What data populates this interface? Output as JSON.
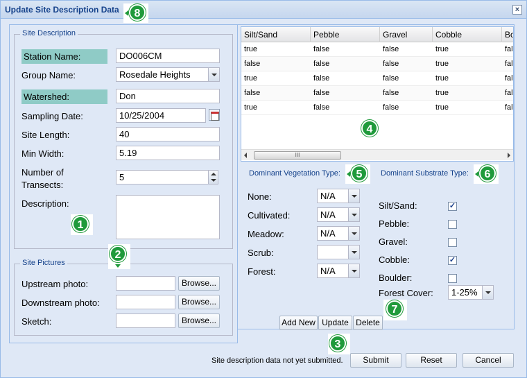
{
  "window": {
    "title": "Update Site Description Data",
    "close": "×"
  },
  "site_description": {
    "legend": "Site Description",
    "station_name": {
      "label": "Station Name:",
      "value": "DO006CM"
    },
    "group_name": {
      "label": "Group Name:",
      "value": "Rosedale Heights"
    },
    "watershed": {
      "label": "Watershed:",
      "value": "Don"
    },
    "sampling_date": {
      "label": "Sampling Date:",
      "value": "10/25/2004"
    },
    "site_length": {
      "label": "Site Length:",
      "value": "40"
    },
    "min_width": {
      "label": "Min Width:",
      "value": "5.19"
    },
    "transects": {
      "label_line1": "Number of",
      "label_line2": "Transects:",
      "value": "5"
    },
    "description": {
      "label": "Description:",
      "value": ""
    }
  },
  "site_pictures": {
    "legend": "Site Pictures",
    "rows": [
      {
        "label": "Upstream photo:",
        "button": "Browse..."
      },
      {
        "label": "Downstream photo:",
        "button": "Browse..."
      },
      {
        "label": "Sketch:",
        "button": "Browse..."
      }
    ]
  },
  "grid": {
    "columns": [
      "Silt/Sand",
      "Pebble",
      "Gravel",
      "Cobble",
      "Bo"
    ],
    "rows": [
      [
        "true",
        "false",
        "false",
        "true",
        "fal"
      ],
      [
        "false",
        "false",
        "false",
        "true",
        "fal"
      ],
      [
        "true",
        "false",
        "false",
        "true",
        "fal"
      ],
      [
        "false",
        "false",
        "false",
        "true",
        "fal"
      ],
      [
        "true",
        "false",
        "false",
        "true",
        "fal"
      ]
    ],
    "scroll_thumb": "III"
  },
  "vegetation": {
    "title": "Dominant Vegetation Type:",
    "items": [
      {
        "label": "None:",
        "value": "N/A"
      },
      {
        "label": "Cultivated:",
        "value": "N/A"
      },
      {
        "label": "Meadow:",
        "value": "N/A"
      },
      {
        "label": "Scrub:",
        "value": ""
      },
      {
        "label": "Forest:",
        "value": "N/A"
      }
    ]
  },
  "substrate": {
    "title": "Dominant Substrate Type:",
    "items": [
      {
        "label": "Silt/Sand:",
        "checked": true,
        "mark": "✓"
      },
      {
        "label": "Pebble:",
        "checked": false,
        "mark": ""
      },
      {
        "label": "Gravel:",
        "checked": false,
        "mark": ""
      },
      {
        "label": "Cobble:",
        "checked": true,
        "mark": "✓"
      },
      {
        "label": "Boulder:",
        "checked": false,
        "mark": ""
      }
    ],
    "forest_cover": {
      "label": "Forest Cover:",
      "value": "1-25%"
    }
  },
  "grid_buttons": {
    "add": "Add New",
    "update": "Update",
    "delete": "Delete"
  },
  "footer": {
    "status": "Site description data not yet submitted.",
    "submit": "Submit",
    "reset": "Reset",
    "cancel": "Cancel"
  },
  "badges": [
    "1",
    "2",
    "3",
    "4",
    "5",
    "6",
    "7",
    "8"
  ]
}
